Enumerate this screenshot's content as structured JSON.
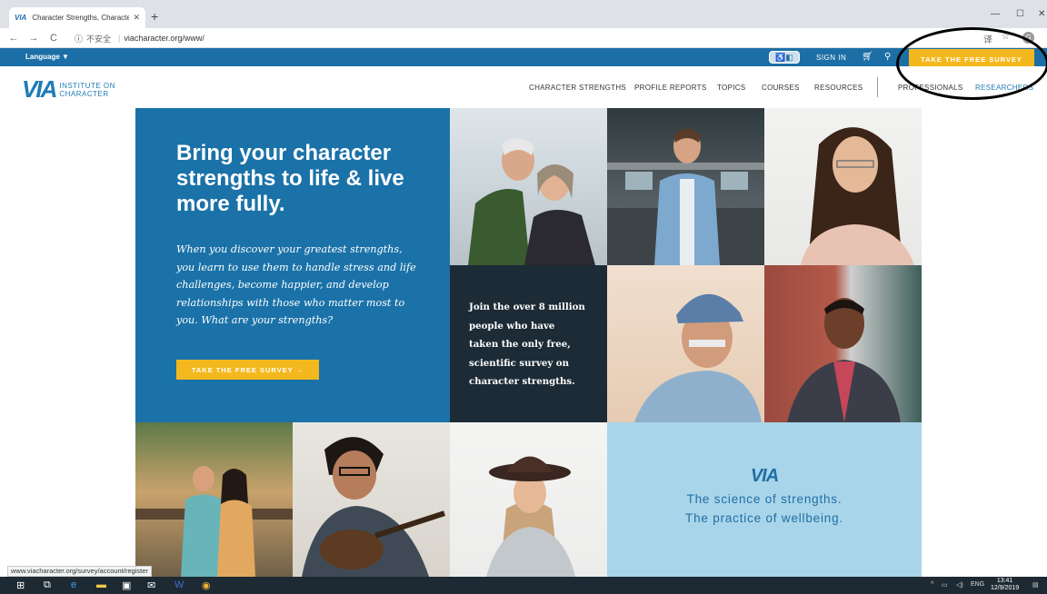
{
  "browser": {
    "tab_title": "Character Strengths, Characte",
    "tab_favicon": "VIA",
    "new_tab": "+",
    "url": "viacharacter.org/www/",
    "insecure_label": "不安全",
    "minimize": "—",
    "maximize": "☐",
    "close": "✕"
  },
  "topbar": {
    "language": "Language ▼",
    "sign_in": "SIGN IN",
    "cta": "TAKE THE FREE SURVEY"
  },
  "logo": {
    "mark": "VIA",
    "line1": "INSTITUTE ON",
    "line2": "CHARACTER"
  },
  "nav": [
    {
      "label": "CHARACTER STRENGTHS"
    },
    {
      "label": "PROFILE REPORTS"
    },
    {
      "label": "TOPICS"
    },
    {
      "label": "COURSES"
    },
    {
      "label": "RESOURCES"
    },
    {
      "label": "PROFESSIONALS"
    },
    {
      "label": "RESEARCHERS"
    }
  ],
  "hero": {
    "title": "Bring your character strengths to life & live more fully.",
    "body": "When you discover your greatest strengths, you learn to use them to handle stress and life challenges, become happier, and develop relationships with those who matter most to you. What are your strengths?",
    "cta": "TAKE THE FREE SURVEY →"
  },
  "callout": {
    "text": "Join the over 8 million people who have taken the only free, scientific survey on character strengths."
  },
  "science": {
    "mark": "VIA",
    "line1": "The science of strengths.",
    "line2": "The practice of wellbeing."
  },
  "status_url": "www.viacharacter.org/survey/account/register",
  "taskbar": {
    "lang": "ENG",
    "time": "13:41",
    "date": "12/9/2019"
  },
  "colors": {
    "brand_blue": "#1b72a8",
    "accent_yellow": "#f4b81f",
    "dark_tile": "#1c2b36",
    "light_blue": "#a9d5ea"
  }
}
